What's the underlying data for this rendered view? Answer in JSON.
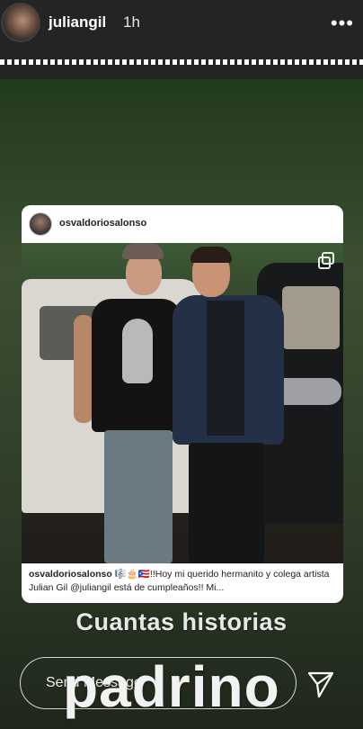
{
  "header": {
    "username": "juliangil",
    "time_ago": "1h",
    "more_glyph": "•••"
  },
  "post": {
    "username": "osvaldoriosalonso",
    "caption_user": "osvaldoriosalonso",
    "caption_text": "🎼🎂🇵🇷!!Hoy mi querido hermanito y colega artista Julian Gil @juliangil está de cumpleaños!! Mi..."
  },
  "story_text": {
    "line1": "Cuantas historias",
    "line2": "padrino"
  },
  "footer": {
    "message_placeholder": "Send Message"
  },
  "icons": {
    "more": "more-options-icon",
    "send": "send-icon",
    "carousel": "carousel-icon"
  },
  "colors": {
    "topbar": "#232424",
    "story_bg": "#3c4f32",
    "text": "#ffffff"
  }
}
